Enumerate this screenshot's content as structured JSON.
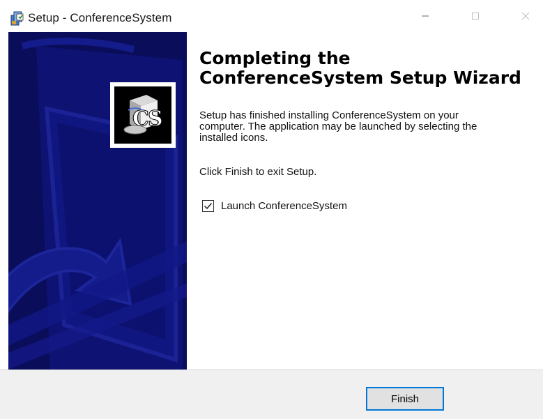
{
  "window": {
    "title": "Setup - ConferenceSystem",
    "app_icon": "installer-icon"
  },
  "window_controls": {
    "minimize_icon": "minimize-icon",
    "maximize_icon": "maximize-icon",
    "close_icon": "close-icon"
  },
  "banner": {
    "background_color": "#0a0d5a",
    "logo_icon": "cs-logo-icon"
  },
  "content": {
    "heading_line1": "Completing the",
    "heading_line2": "ConferenceSystem Setup Wizard",
    "description_line1": "Setup has finished installing ConferenceSystem on your",
    "description_line2": "computer. The application may be launched by selecting the",
    "description_line3": "installed icons.",
    "click_instruction": "Click Finish to exit Setup.",
    "launch_checkbox_label": "Launch ConferenceSystem",
    "launch_checked": true
  },
  "footer": {
    "finish_label": "Finish",
    "accent_color": "#0078d7"
  }
}
